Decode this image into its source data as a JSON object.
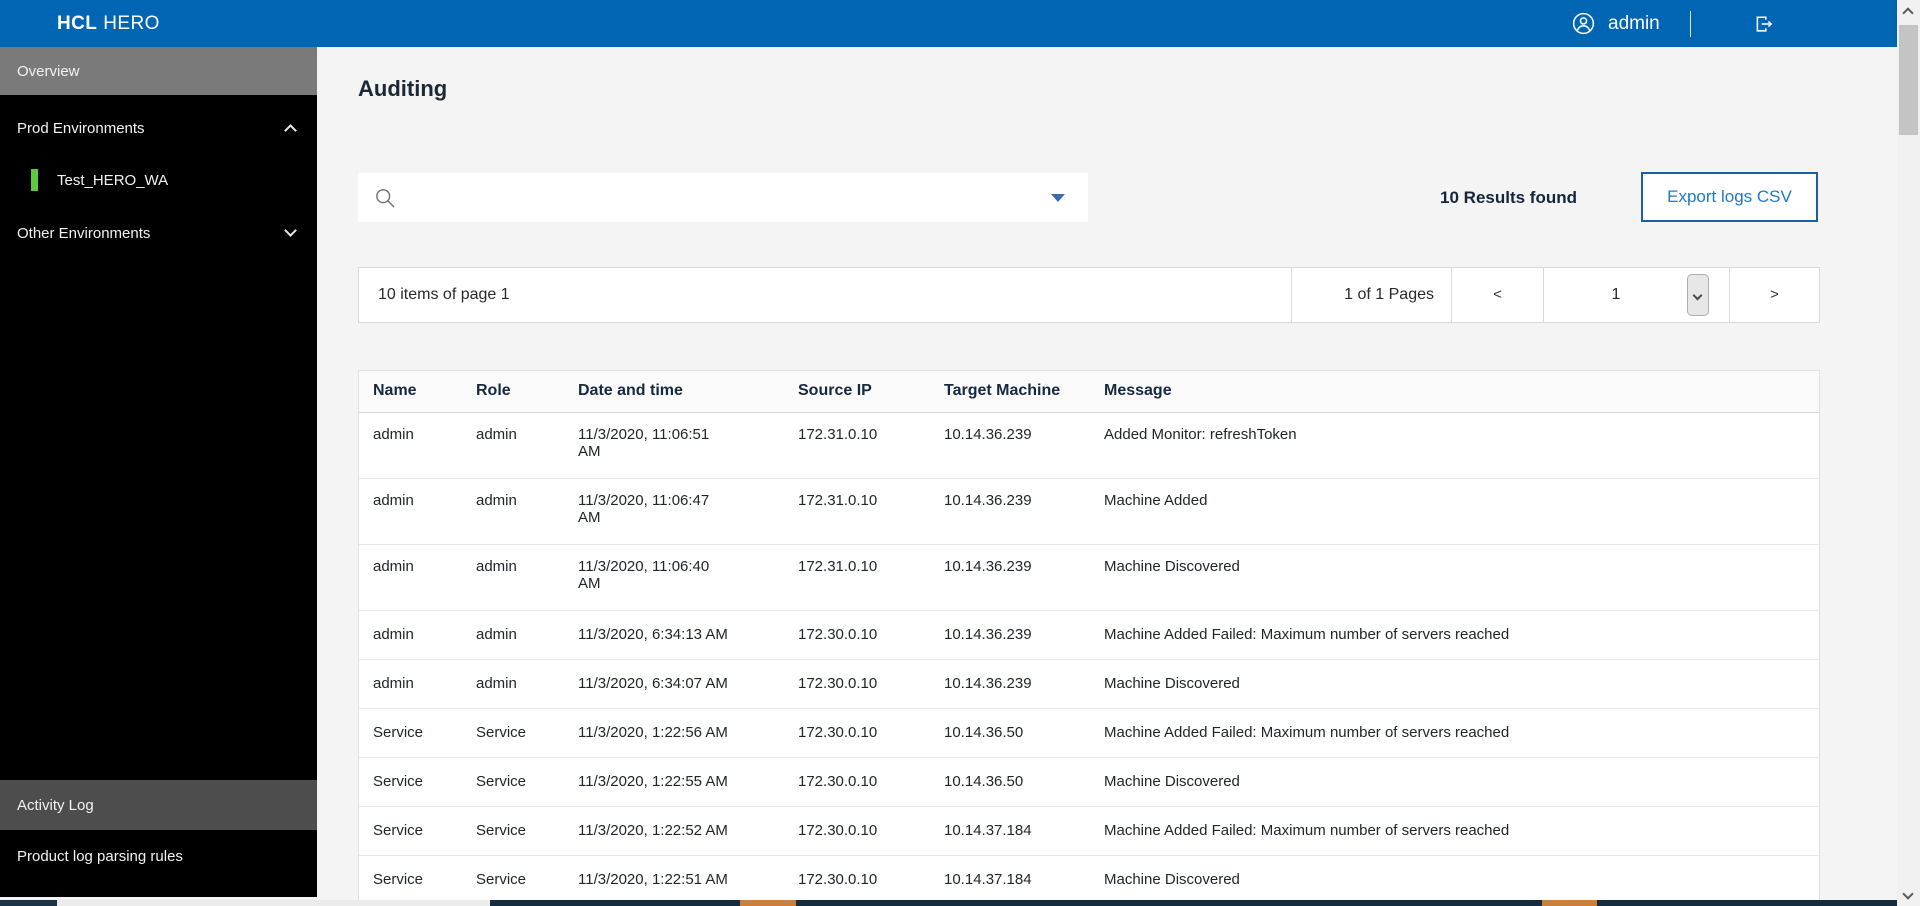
{
  "header": {
    "logo": {
      "hcl": "HCL",
      "hero": "HERO"
    },
    "user": "admin"
  },
  "sidebar": {
    "overview": "Overview",
    "prod_environments": "Prod Environments",
    "prod_items": [
      {
        "label": "Test_HERO_WA",
        "status_color": "#5ecb3e"
      }
    ],
    "other_environments": "Other Environments",
    "activity_log": "Activity Log",
    "product_log_rules": "Product log parsing rules"
  },
  "main": {
    "title": "Auditing",
    "search": {
      "value": "",
      "placeholder": ""
    },
    "results_found": "10 Results found",
    "export_label": "Export logs CSV",
    "pagination": {
      "items_text": "10 items of page 1",
      "pages_text": "1 of 1 Pages",
      "prev_label": "<",
      "next_label": ">",
      "current_page": "1"
    },
    "table": {
      "columns": [
        "Name",
        "Role",
        "Date and time",
        "Source IP",
        "Target Machine",
        "Message"
      ],
      "rows": [
        [
          "admin",
          "admin",
          "11/3/2020, 11:06:51\nAM",
          "172.31.0.10",
          "10.14.36.239",
          "Added Monitor: refreshToken"
        ],
        [
          "admin",
          "admin",
          "11/3/2020, 11:06:47\nAM",
          "172.31.0.10",
          "10.14.36.239",
          "Machine Added"
        ],
        [
          "admin",
          "admin",
          "11/3/2020, 11:06:40\nAM",
          "172.31.0.10",
          "10.14.36.239",
          "Machine Discovered"
        ],
        [
          "admin",
          "admin",
          "11/3/2020, 6:34:13 AM",
          "172.30.0.10",
          "10.14.36.239",
          "Machine Added Failed: Maximum number of servers reached"
        ],
        [
          "admin",
          "admin",
          "11/3/2020, 6:34:07 AM",
          "172.30.0.10",
          "10.14.36.239",
          "Machine Discovered"
        ],
        [
          "Service",
          "Service",
          "11/3/2020, 1:22:56 AM",
          "172.30.0.10",
          "10.14.36.50",
          "Machine Added Failed: Maximum number of servers reached"
        ],
        [
          "Service",
          "Service",
          "11/3/2020, 1:22:55 AM",
          "172.30.0.10",
          "10.14.36.50",
          "Machine Discovered"
        ],
        [
          "Service",
          "Service",
          "11/3/2020, 1:22:52 AM",
          "172.30.0.10",
          "10.14.37.184",
          "Machine Added Failed: Maximum number of servers reached"
        ],
        [
          "Service",
          "Service",
          "11/3/2020, 1:22:51 AM",
          "172.30.0.10",
          "10.14.37.184",
          "Machine Discovered"
        ]
      ]
    }
  },
  "icons": {
    "user": "user-circle-icon",
    "logout": "logout-icon",
    "search": "magnifier-icon",
    "dropdown": "caret-down-icon",
    "expand": "chevron-up-icon",
    "collapse": "chevron-down-icon"
  },
  "colors": {
    "topbar_blue": "#0066b3",
    "sidebar_black": "#000000",
    "overview_gray": "#7a7a7a",
    "activity_gray": "#4d4d4d",
    "env_green": "#5ecb3e",
    "accent_blue_text": "#1f79c7",
    "export_border_blue": "#1a5f9e",
    "footer_navy": "#162c3d",
    "footer_orange": "#c8803c"
  }
}
